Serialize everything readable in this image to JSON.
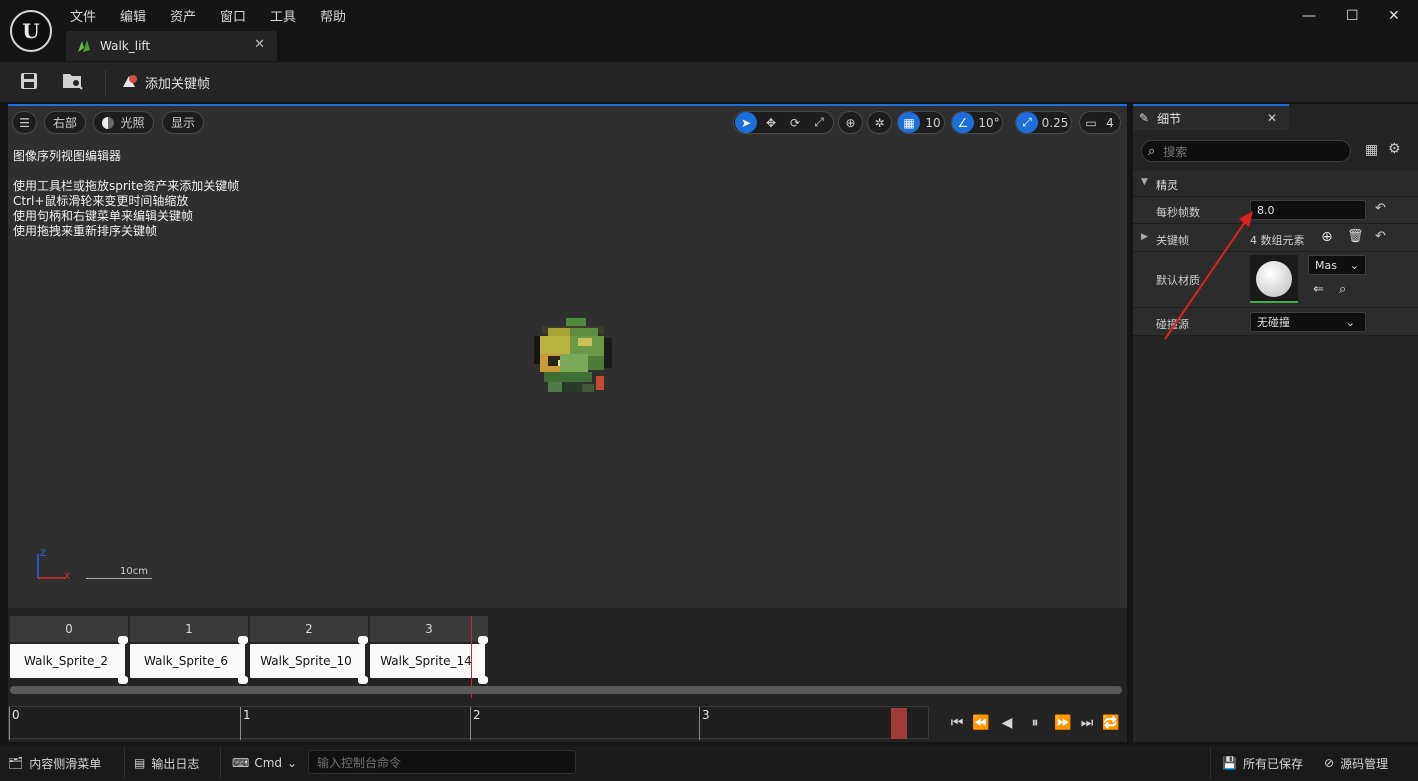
{
  "app": {
    "logo": "U",
    "menu": [
      "文件",
      "编辑",
      "资产",
      "窗口",
      "工具",
      "帮助"
    ],
    "tab_title": "Walk_lift",
    "window_controls": [
      "minimize-icon",
      "maximize-icon",
      "close-icon"
    ]
  },
  "toolbar": {
    "add_keyframe_label": "添加关键帧"
  },
  "viewport": {
    "view_label": "右部",
    "lighting_label": "光照",
    "show_label": "显示",
    "grid_snap_value": "10",
    "rotation_snap_value": "10°",
    "scale_snap_value": "0.25",
    "camera_speed_value": "4",
    "title": "图像序列视图编辑器",
    "hints": [
      "使用工具栏或拖放sprite资产来添加关键帧",
      "Ctrl+鼠标滑轮来变更时间轴缩放",
      "使用句柄和右键菜单来编辑关键帧",
      "使用拖拽来重新排序关键帧"
    ],
    "scale_label": "10cm",
    "axis_x": "X",
    "axis_z": "Z"
  },
  "timeline": {
    "frames": [
      {
        "index": "0",
        "name": "Walk_Sprite_2"
      },
      {
        "index": "1",
        "name": "Walk_Sprite_6"
      },
      {
        "index": "2",
        "name": "Walk_Sprite_10"
      },
      {
        "index": "3",
        "name": "Walk_Sprite_14"
      }
    ],
    "ruler_labels": [
      "0",
      "1",
      "2",
      "3"
    ]
  },
  "details": {
    "tab_title": "细节",
    "search_placeholder": "搜索",
    "category": "精灵",
    "fps_label": "每秒帧数",
    "fps_value": "8.0",
    "keyframes_label": "关键帧",
    "keyframes_value": "4 数组元素",
    "material_label": "默认材质",
    "material_dropdown": "Mas",
    "collision_label": "碰撞源",
    "collision_value": "无碰撞"
  },
  "statusbar": {
    "content_drawer": "内容侧滑菜单",
    "output_log": "输出日志",
    "cmd": "Cmd",
    "console_placeholder": "输入控制台命令",
    "all_saved": "所有已保存",
    "source_control": "源码管理"
  },
  "colors": {
    "accent": "#1c6edb",
    "playhead": "#c62828",
    "annotation_arrow": "#e02020"
  }
}
